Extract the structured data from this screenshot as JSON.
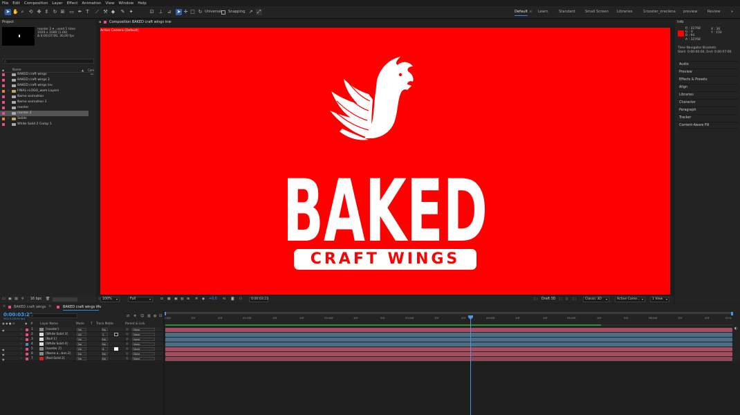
{
  "menu": [
    "File",
    "Edit",
    "Composition",
    "Layer",
    "Effect",
    "Animation",
    "View",
    "Window",
    "Help"
  ],
  "toolbar": {
    "universal_label": "Universal",
    "snapping_label": "Snapping",
    "workspaces": [
      "Default",
      "Learn",
      "Standard",
      "Small Screen",
      "Libraries",
      "1rooster_oraclena",
      "preview",
      "Review"
    ],
    "active_workspace": "Default"
  },
  "project": {
    "title": "Project",
    "selected_name": "rooster 2 ▾ , used 1 time",
    "selected_dims": "1920 x 1080 (1.00)",
    "selected_duration": "Δ 0;00;07;00, 30,00 fps",
    "col_name": "Name",
    "col_comment": "Com",
    "items": [
      {
        "name": "BAKED craft wings",
        "color": "#e84c8a",
        "type": "comp",
        "twirl": ""
      },
      {
        "name": "BAKED craft wings 2",
        "color": "#e84c8a",
        "type": "comp",
        "twirl": ""
      },
      {
        "name": "BAKED craft wings inv",
        "color": "#e84c8a",
        "type": "comp",
        "twirl": ""
      },
      {
        "name": "FINAL+LOGO_wam Layers",
        "color": "#d98c2b",
        "type": "folder",
        "twirl": "›"
      },
      {
        "name": "Name animation",
        "color": "#e84c8a",
        "type": "comp",
        "twirl": ""
      },
      {
        "name": "Name animation 2",
        "color": "#e84c8a",
        "type": "comp",
        "twirl": ""
      },
      {
        "name": "rooster",
        "color": "#e84c8a",
        "type": "comp",
        "twirl": ""
      },
      {
        "name": "rooster 2",
        "color": "#e84c8a",
        "type": "comp",
        "twirl": "",
        "selected": true
      },
      {
        "name": "Solids",
        "color": "#d98c2b",
        "type": "folder",
        "twirl": "›"
      },
      {
        "name": "White Solid 2 Comp 1",
        "color": "#e84c8a",
        "type": "comp",
        "twirl": ""
      }
    ],
    "bpc": "16 bpc"
  },
  "composition": {
    "tab_label": "Composition BAKED craft wings inv",
    "camera_label": "Active Camera (Default)",
    "logo_main": "BAKED",
    "logo_sub": "CRAFT WINGS",
    "bg_color": "#ff0000",
    "footer": {
      "zoom": "100%",
      "resolution": "Full",
      "exposure": "+0,0",
      "timecode": "0:00:03:23",
      "draft": "Draft 3D",
      "renderer": "Classic 3D",
      "camera": "Active Came...",
      "views": "1 View"
    }
  },
  "info": {
    "title": "Info",
    "r": "R : 32768",
    "g": "G : 0",
    "b": "B : 94",
    "a": "A : 32768",
    "x": "X : 36",
    "y": "Y : 150",
    "brackets_title": "Time Navigator Brackets",
    "brackets_value": "Start: 0:00:00:00, End: 0:00:07:00",
    "sections": [
      "Audio",
      "Preview",
      "Effects & Presets",
      "Align",
      "Libraries",
      "Character",
      "Paragraph",
      "Tracker",
      "Content-Aware Fill"
    ]
  },
  "timeline": {
    "tabs": [
      "BAKED craft wings",
      "BAKED craft wings inv"
    ],
    "active_tab": "BAKED craft wings inv",
    "timecode": "0:00:03:23",
    "timecode_sub": "00113 (30.00 fps)",
    "col_layer_name": "Layer Name",
    "col_mode": "Mode",
    "col_t": "T",
    "col_trkmat": "Track Matte",
    "col_parent": "Parent & Link",
    "ruler": [
      "0:00f",
      "10f",
      "20f",
      "01:00f",
      "10f",
      "20f",
      "02:00f",
      "10f",
      "20f",
      "03:00f",
      "10f",
      "20f",
      "04:00f",
      "10f",
      "20f",
      "05:00f",
      "10f",
      "20f",
      "06:00f",
      "10f",
      "20f",
      "07:0"
    ],
    "layers": [
      {
        "num": "1",
        "name": "[rooster]",
        "mode": "No",
        "trk": "No",
        "parent": "None",
        "color": "#e84c8a",
        "bar": "#a74d62"
      },
      {
        "num": "2",
        "name": "[White Solid 3]",
        "mode": "Ad",
        "trk": "1.",
        "parent": "None",
        "color": "#e84c8a",
        "bar": "#4d6f86"
      },
      {
        "num": "3",
        "name": "[Null 1]",
        "mode": "No",
        "trk": "No",
        "parent": "None",
        "color": "#e84c8a",
        "bar": "#4d6f86"
      },
      {
        "num": "4",
        "name": "[White Solid 4]",
        "mode": "No",
        "trk": "No",
        "parent": "None",
        "color": "#4a8ec7",
        "bar": "#4d6f86"
      },
      {
        "num": "5",
        "name": "[rooster 2]",
        "mode": "No",
        "trk": "4.",
        "parent": "None",
        "color": "#e84c8a",
        "bar": "#a74d62"
      },
      {
        "num": "6",
        "name": "[Name a...tion 2]",
        "mode": "No",
        "trk": "No",
        "parent": "None",
        "color": "#e84c8a",
        "bar": "#a74d62"
      },
      {
        "num": "7",
        "name": "[Red Solid 2]",
        "mode": "No",
        "trk": "No",
        "parent": "None",
        "color": "#d42020",
        "bar": "#8b4a55"
      }
    ]
  }
}
